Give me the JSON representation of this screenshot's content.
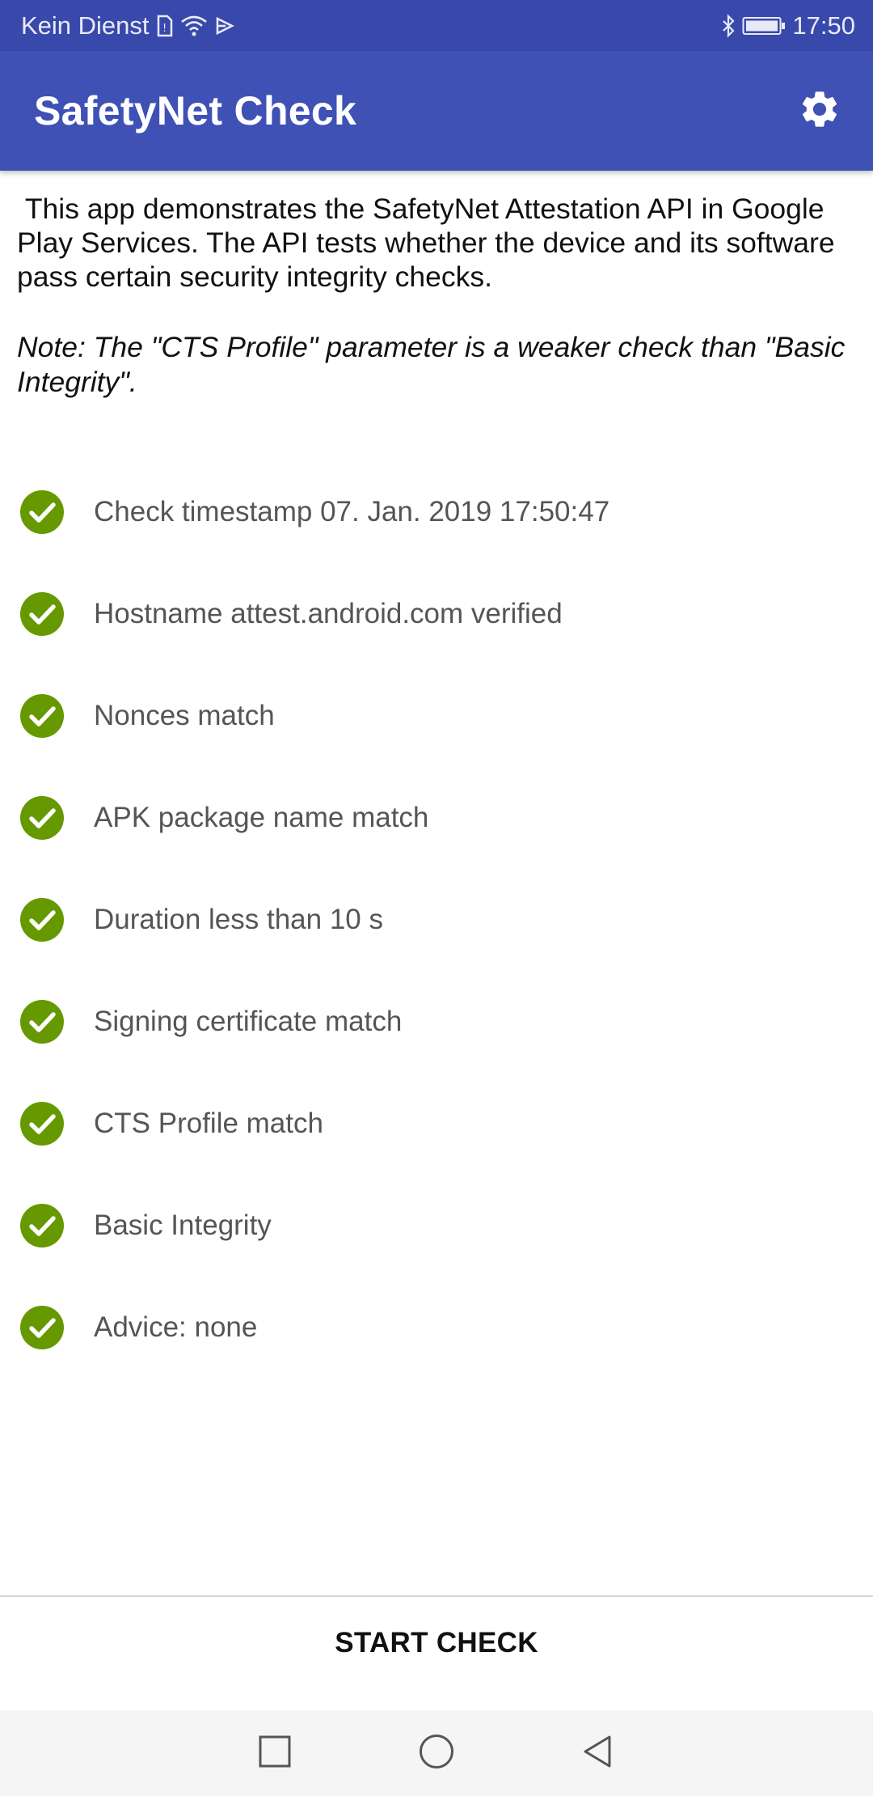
{
  "status_bar": {
    "carrier": "Kein Dienst",
    "time": "17:50",
    "icons": [
      "sim-icon",
      "wifi-icon",
      "cast-icon",
      "bluetooth-icon",
      "battery-icon"
    ]
  },
  "app_bar": {
    "title": "SafetyNet Check",
    "settings_icon": "gear-icon"
  },
  "description": " This app demonstrates the SafetyNet Attestation API in Google Play Services. The API tests whether the device and its software pass certain security integrity checks.",
  "note": "Note: The \"CTS Profile\" parameter is a weaker check than \"Basic Integrity\".",
  "checks": [
    {
      "label": "Check timestamp 07. Jan. 2019 17:50:47",
      "status": "pass"
    },
    {
      "label": "Hostname attest.android.com verified",
      "status": "pass"
    },
    {
      "label": "Nonces match",
      "status": "pass"
    },
    {
      "label": "APK package name match",
      "status": "pass"
    },
    {
      "label": "Duration less than 10 s",
      "status": "pass"
    },
    {
      "label": "Signing certificate match",
      "status": "pass"
    },
    {
      "label": "CTS Profile match",
      "status": "pass"
    },
    {
      "label": "Basic Integrity",
      "status": "pass"
    },
    {
      "label": "Advice: none",
      "status": "pass"
    }
  ],
  "start_button": "START CHECK",
  "colors": {
    "status_bar": "#3949ab",
    "app_bar": "#3f51b5",
    "check_green": "#669900"
  },
  "nav_bar": {
    "icons": [
      "recents-icon",
      "home-icon",
      "back-icon"
    ]
  }
}
